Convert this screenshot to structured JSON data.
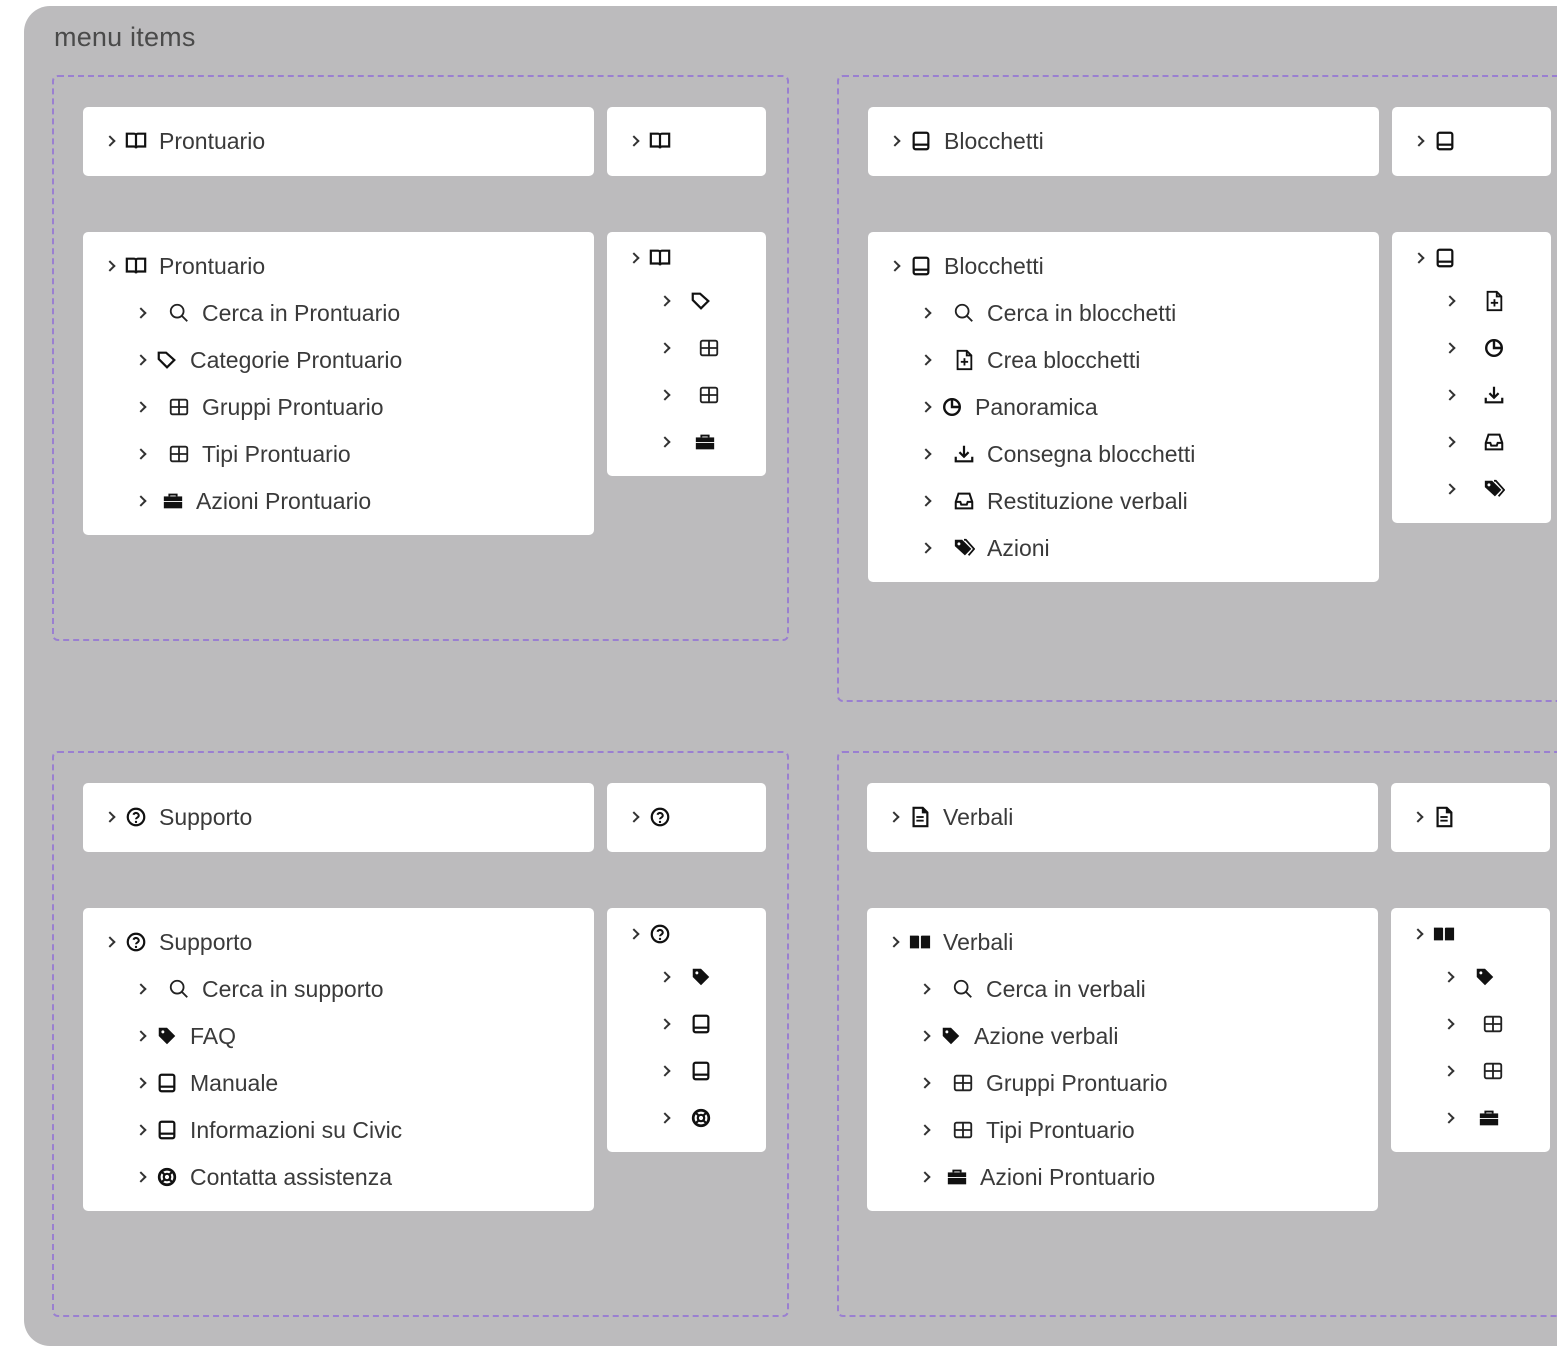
{
  "frame_title": "menu items",
  "sections": {
    "prontuario": {
      "title": "Prontuario",
      "icon": "book-open-icon",
      "items": [
        {
          "label": "Cerca in Prontuario",
          "icon": "search-icon"
        },
        {
          "label": "Categorie Prontuario",
          "icon": "tag-outline-icon"
        },
        {
          "label": "Gruppi Prontuario",
          "icon": "grid-icon"
        },
        {
          "label": "Tipi Prontuario",
          "icon": "grid-icon"
        },
        {
          "label": "Azioni Prontuario",
          "icon": "toolbox-icon"
        }
      ]
    },
    "blocchetti": {
      "title": "Blocchetti",
      "icon": "notebook-icon",
      "items": [
        {
          "label": "Cerca in blocchetti",
          "icon": "search-icon"
        },
        {
          "label": "Crea blocchetti",
          "icon": "file-plus-icon"
        },
        {
          "label": "Panoramica",
          "icon": "pie-chart-icon"
        },
        {
          "label": "Consegna blocchetti",
          "icon": "download-icon"
        },
        {
          "label": "Restituzione verbali",
          "icon": "inbox-icon"
        },
        {
          "label": "Azioni",
          "icon": "tags-icon"
        }
      ]
    },
    "supporto": {
      "title": "Supporto",
      "icon": "help-circle-icon",
      "items": [
        {
          "label": "Cerca in supporto",
          "icon": "search-icon"
        },
        {
          "label": "FAQ",
          "icon": "tag-filled-icon"
        },
        {
          "label": "Manuale",
          "icon": "notebook-icon"
        },
        {
          "label": "Informazioni su Civic",
          "icon": "notebook-icon"
        },
        {
          "label": "Contatta assistenza",
          "icon": "lifebuoy-icon"
        }
      ]
    },
    "verbali": {
      "title": "Verbali",
      "title_icon_collapsed": "file-text-icon",
      "icon": "book-filled-icon",
      "items": [
        {
          "label": "Cerca in verbali",
          "icon": "search-icon"
        },
        {
          "label": "Azione verbali",
          "icon": "tag-filled-icon"
        },
        {
          "label": "Gruppi Prontuario",
          "icon": "grid-icon"
        },
        {
          "label": "Tipi Prontuario",
          "icon": "grid-icon"
        },
        {
          "label": "Azioni Prontuario",
          "icon": "toolbox-icon"
        }
      ]
    }
  }
}
